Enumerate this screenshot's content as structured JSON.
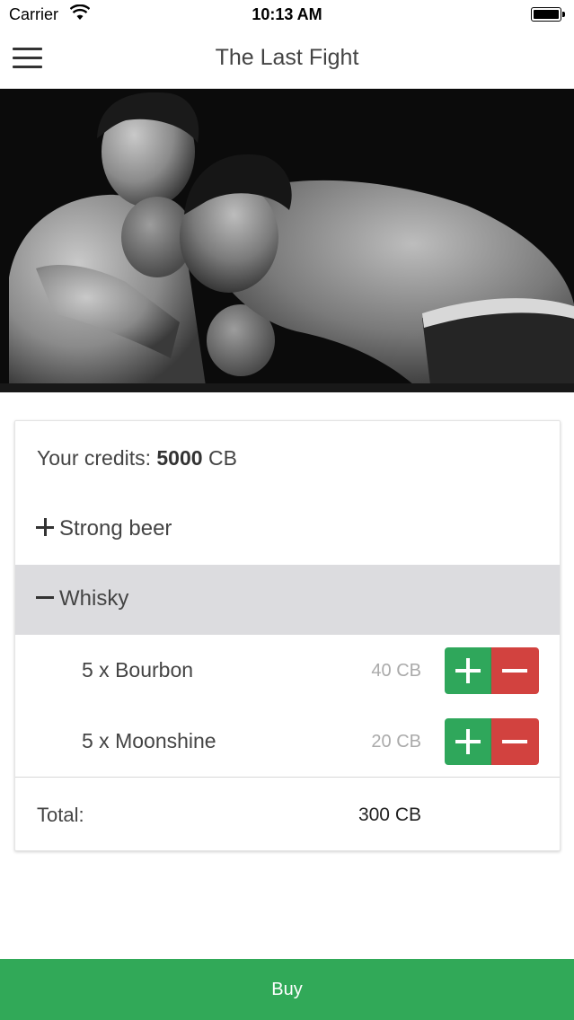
{
  "status_bar": {
    "carrier": "Carrier",
    "time": "10:13 AM"
  },
  "header": {
    "title": "The Last Fight",
    "menu_icon": "hamburger-menu-icon"
  },
  "hero": {
    "image": "black-and-white photo of two boxers in the ring"
  },
  "card": {
    "credits_prefix": "Your credits: ",
    "credits_value": "5000",
    "credits_unit": " CB",
    "categories": [
      {
        "label": "Strong beer",
        "icon": "plus-icon",
        "expanded": false
      },
      {
        "label": "Whisky",
        "icon": "minus-icon",
        "expanded": true
      }
    ],
    "items": [
      {
        "name": "5 x Bourbon",
        "price": "40 CB"
      },
      {
        "name": "5 x Moonshine",
        "price": "20 CB"
      }
    ],
    "total_label": "Total:",
    "total_value": "300 CB"
  },
  "buy_button": {
    "label": "Buy"
  },
  "colors": {
    "add": "#2fa75b",
    "remove": "#d2423f",
    "buy": "#31a958",
    "selected_row": "#dcdcdf"
  }
}
